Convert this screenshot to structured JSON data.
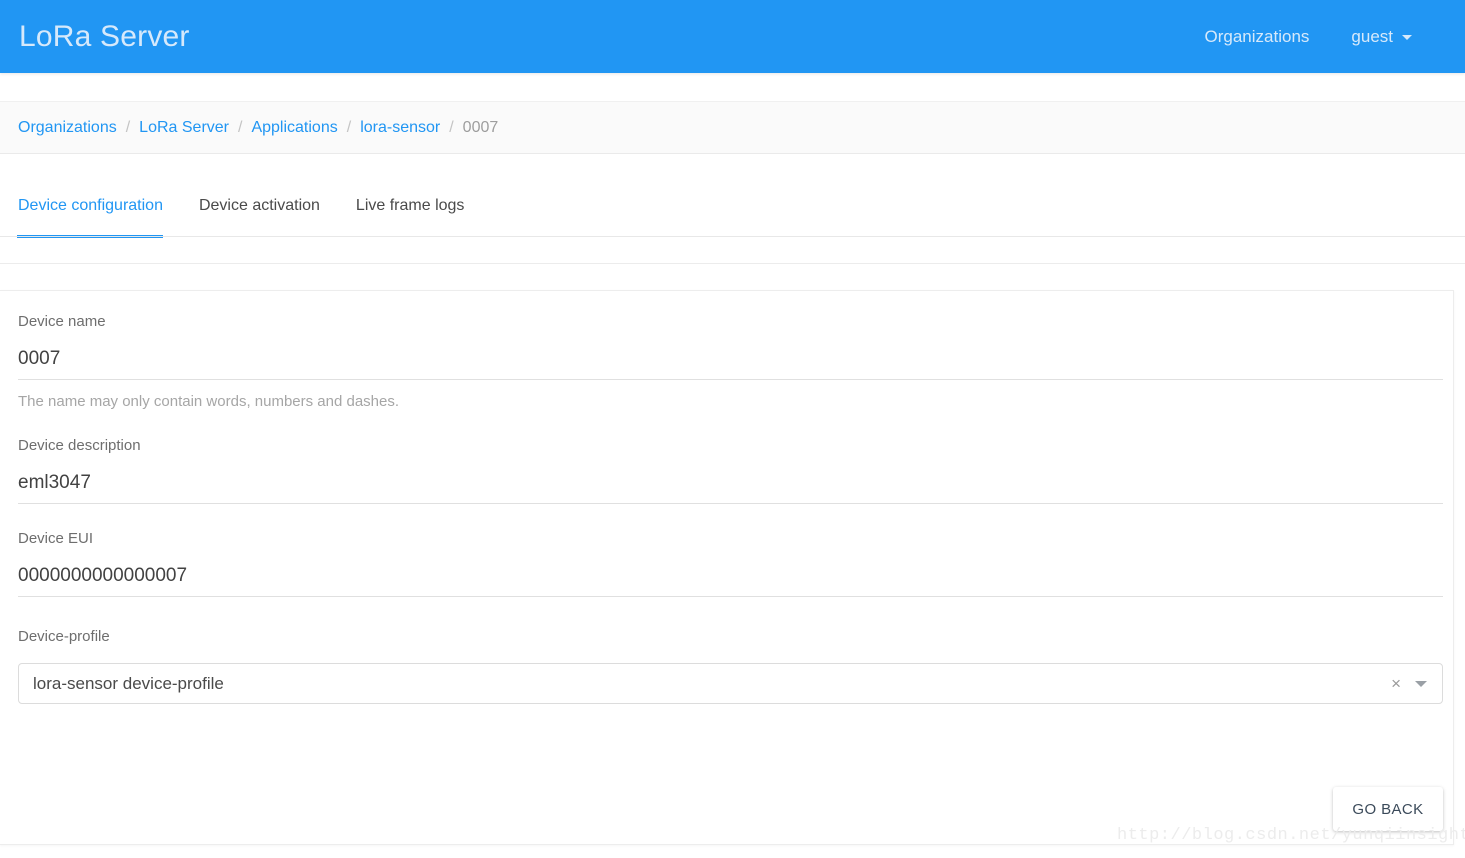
{
  "appbar": {
    "brand": "LoRa Server",
    "organizations_label": "Organizations",
    "user_label": "guest",
    "caret_icon": "chevron-down-icon",
    "background_color": "#2196f3",
    "text_color": "#d6e9fb"
  },
  "breadcrumb": {
    "separator": "/",
    "items": [
      {
        "label": "Organizations",
        "current": false
      },
      {
        "label": "LoRa Server",
        "current": false
      },
      {
        "label": "Applications",
        "current": false
      },
      {
        "label": "lora-sensor",
        "current": false
      },
      {
        "label": "0007",
        "current": true
      }
    ]
  },
  "tabs": [
    {
      "label": "Device configuration",
      "active": true
    },
    {
      "label": "Device activation",
      "active": false
    },
    {
      "label": "Live frame logs",
      "active": false
    }
  ],
  "form": {
    "device_name": {
      "label": "Device name",
      "value": "0007",
      "placeholder": "",
      "help": "The name may only contain words, numbers and dashes."
    },
    "device_description": {
      "label": "Device description",
      "value": "eml3047",
      "placeholder": ""
    },
    "device_eui": {
      "label": "Device EUI",
      "value": "0000000000000007",
      "placeholder": ""
    },
    "device_profile": {
      "label": "Device-profile",
      "value": "lora-sensor device-profile",
      "placeholder": "",
      "clear_icon": "close-icon",
      "clear_glyph": "×",
      "caret_icon": "chevron-down-icon"
    }
  },
  "actions": {
    "go_back_label": "GO BACK"
  },
  "watermark": {
    "text": "http://blog.csdn.net/yunqiinsight"
  },
  "colors": {
    "accent": "#2196f3",
    "label_text": "#6e6e6e",
    "value_text": "#424242",
    "help_text": "#a6a6a6",
    "breadcrumb_bg": "#fafafa"
  }
}
